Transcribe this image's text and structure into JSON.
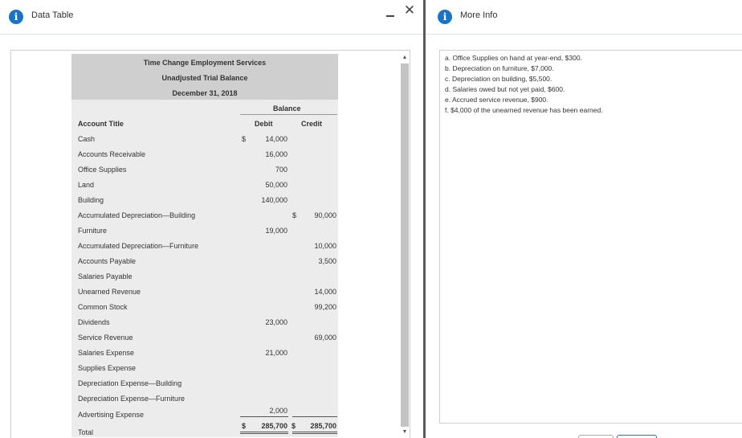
{
  "left_dialog": {
    "title": "Data Table",
    "minimize_label": "",
    "close_label": "✕"
  },
  "trial_balance": {
    "company": "Time Change Employment Services",
    "report": "Unadjusted Trial Balance",
    "date": "December 31, 2018",
    "balance_header": "Balance",
    "col_account": "Account Title",
    "col_debit": "Debit",
    "col_credit": "Credit",
    "rows": [
      {
        "account": "Cash",
        "debit_sign": "$",
        "debit": "14,000",
        "credit_sign": "",
        "credit": ""
      },
      {
        "account": "Accounts Receivable",
        "debit_sign": "",
        "debit": "16,000",
        "credit_sign": "",
        "credit": ""
      },
      {
        "account": "Office Supplies",
        "debit_sign": "",
        "debit": "700",
        "credit_sign": "",
        "credit": ""
      },
      {
        "account": "Land",
        "debit_sign": "",
        "debit": "50,000",
        "credit_sign": "",
        "credit": ""
      },
      {
        "account": "Building",
        "debit_sign": "",
        "debit": "140,000",
        "credit_sign": "",
        "credit": ""
      },
      {
        "account": "Accumulated Depreciation—Building",
        "debit_sign": "",
        "debit": "",
        "credit_sign": "$",
        "credit": "90,000"
      },
      {
        "account": "Furniture",
        "debit_sign": "",
        "debit": "19,000",
        "credit_sign": "",
        "credit": ""
      },
      {
        "account": "Accumulated Depreciation—Furniture",
        "debit_sign": "",
        "debit": "",
        "credit_sign": "",
        "credit": "10,000"
      },
      {
        "account": "Accounts Payable",
        "debit_sign": "",
        "debit": "",
        "credit_sign": "",
        "credit": "3,500"
      },
      {
        "account": "Salaries Payable",
        "debit_sign": "",
        "debit": "",
        "credit_sign": "",
        "credit": ""
      },
      {
        "account": "Unearned Revenue",
        "debit_sign": "",
        "debit": "",
        "credit_sign": "",
        "credit": "14,000"
      },
      {
        "account": "Common Stock",
        "debit_sign": "",
        "debit": "",
        "credit_sign": "",
        "credit": "99,200"
      },
      {
        "account": "Dividends",
        "debit_sign": "",
        "debit": "23,000",
        "credit_sign": "",
        "credit": ""
      },
      {
        "account": "Service Revenue",
        "debit_sign": "",
        "debit": "",
        "credit_sign": "",
        "credit": "69,000"
      },
      {
        "account": "Salaries Expense",
        "debit_sign": "",
        "debit": "21,000",
        "credit_sign": "",
        "credit": ""
      },
      {
        "account": "Supplies Expense",
        "debit_sign": "",
        "debit": "",
        "credit_sign": "",
        "credit": ""
      },
      {
        "account": "Depreciation Expense—Building",
        "debit_sign": "",
        "debit": "",
        "credit_sign": "",
        "credit": ""
      },
      {
        "account": "Depreciation Expense—Furniture",
        "debit_sign": "",
        "debit": "",
        "credit_sign": "",
        "credit": ""
      }
    ],
    "advertising": {
      "account": "Advertising Expense",
      "debit": "2,000"
    },
    "total": {
      "account": "Total",
      "debit_sign": "$",
      "debit": "285,700",
      "credit_sign": "$",
      "credit": "285,700"
    }
  },
  "right_dialog": {
    "title": "More Info",
    "items": [
      "a.  Office Supplies on hand at year-end, $300.",
      "b.  Depreciation on furniture, $7,000.",
      "c.  Depreciation on building, $5,500.",
      "d.  Salaries owed but not yet paid, $600.",
      "e.  Accrued service revenue, $900.",
      "f.   $4,000 of the unearned revenue has been earned."
    ]
  },
  "colors": {
    "accent": "#1a73c5",
    "table_header_gray": "#cfcfcf",
    "table_body_gray": "#ececec",
    "divider": "#5a5a5a"
  },
  "icons": [
    "info-icon",
    "minimize-icon",
    "close-icon",
    "scroll-up-icon",
    "scroll-down-icon"
  ]
}
